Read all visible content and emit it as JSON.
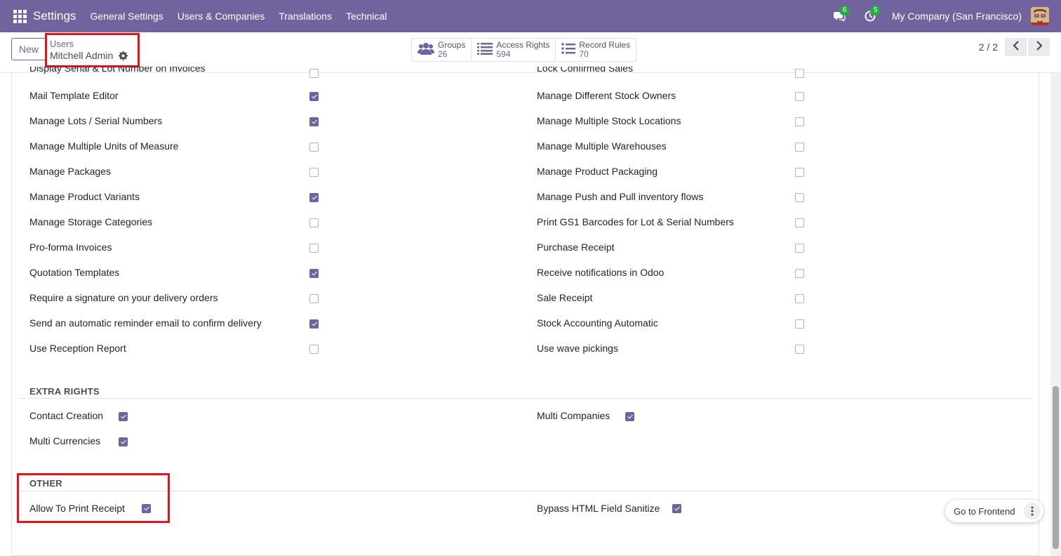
{
  "navbar": {
    "brand": "Settings",
    "menu": [
      "General Settings",
      "Users & Companies",
      "Translations",
      "Technical"
    ],
    "messages_count": "6",
    "activities_count": "5",
    "company": "My Company (San Francisco)"
  },
  "control": {
    "new_label": "New",
    "breadcrumb_parent": "Users",
    "breadcrumb_current": "Mitchell Admin",
    "smart_buttons": [
      {
        "label": "Groups",
        "value": "26",
        "icon": "users-icon"
      },
      {
        "label": "Access Rights",
        "value": "594",
        "icon": "list-icon"
      },
      {
        "label": "Record Rules",
        "value": "70",
        "icon": "list-icon"
      }
    ],
    "pager": "2 / 2"
  },
  "rights": {
    "cut_left": "Display Serial & Lot Number on Invoices",
    "cut_right": "Lock Confirmed Sales",
    "left": [
      {
        "label": "Mail Template Editor",
        "checked": true
      },
      {
        "label": "Manage Lots / Serial Numbers",
        "checked": true
      },
      {
        "label": "Manage Multiple Units of Measure",
        "checked": false
      },
      {
        "label": "Manage Packages",
        "checked": false
      },
      {
        "label": "Manage Product Variants",
        "checked": true
      },
      {
        "label": "Manage Storage Categories",
        "checked": false
      },
      {
        "label": "Pro-forma Invoices",
        "checked": false
      },
      {
        "label": "Quotation Templates",
        "checked": true
      },
      {
        "label": "Require a signature on your delivery orders",
        "checked": false
      },
      {
        "label": "Send an automatic reminder email to confirm delivery",
        "checked": true
      },
      {
        "label": "Use Reception Report",
        "checked": false
      }
    ],
    "right": [
      {
        "label": "Manage Different Stock Owners",
        "checked": false
      },
      {
        "label": "Manage Multiple Stock Locations",
        "checked": false
      },
      {
        "label": "Manage Multiple Warehouses",
        "checked": false
      },
      {
        "label": "Manage Product Packaging",
        "checked": false
      },
      {
        "label": "Manage Push and Pull inventory flows",
        "checked": false
      },
      {
        "label": "Print GS1 Barcodes for Lot & Serial Numbers",
        "checked": false
      },
      {
        "label": "Purchase Receipt",
        "checked": false
      },
      {
        "label": "Receive notifications in Odoo",
        "checked": false
      },
      {
        "label": "Sale Receipt",
        "checked": false
      },
      {
        "label": "Stock Accounting Automatic",
        "checked": false
      },
      {
        "label": "Use wave pickings",
        "checked": false
      }
    ]
  },
  "extra_rights": {
    "title": "EXTRA RIGHTS",
    "items": [
      {
        "label": "Contact Creation",
        "checked": true
      },
      {
        "label": "Multi Companies",
        "checked": true
      },
      {
        "label": "Multi Currencies",
        "checked": true
      }
    ]
  },
  "other": {
    "title": "OTHER",
    "items": [
      {
        "label": "Allow To Print Receipt",
        "checked": true
      },
      {
        "label": "Bypass HTML Field Sanitize",
        "checked": true
      }
    ]
  },
  "floating": {
    "button": "Go to Frontend"
  },
  "colors": {
    "brand": "#71639e",
    "highlight": "#e8121c",
    "badge": "#28a745"
  }
}
